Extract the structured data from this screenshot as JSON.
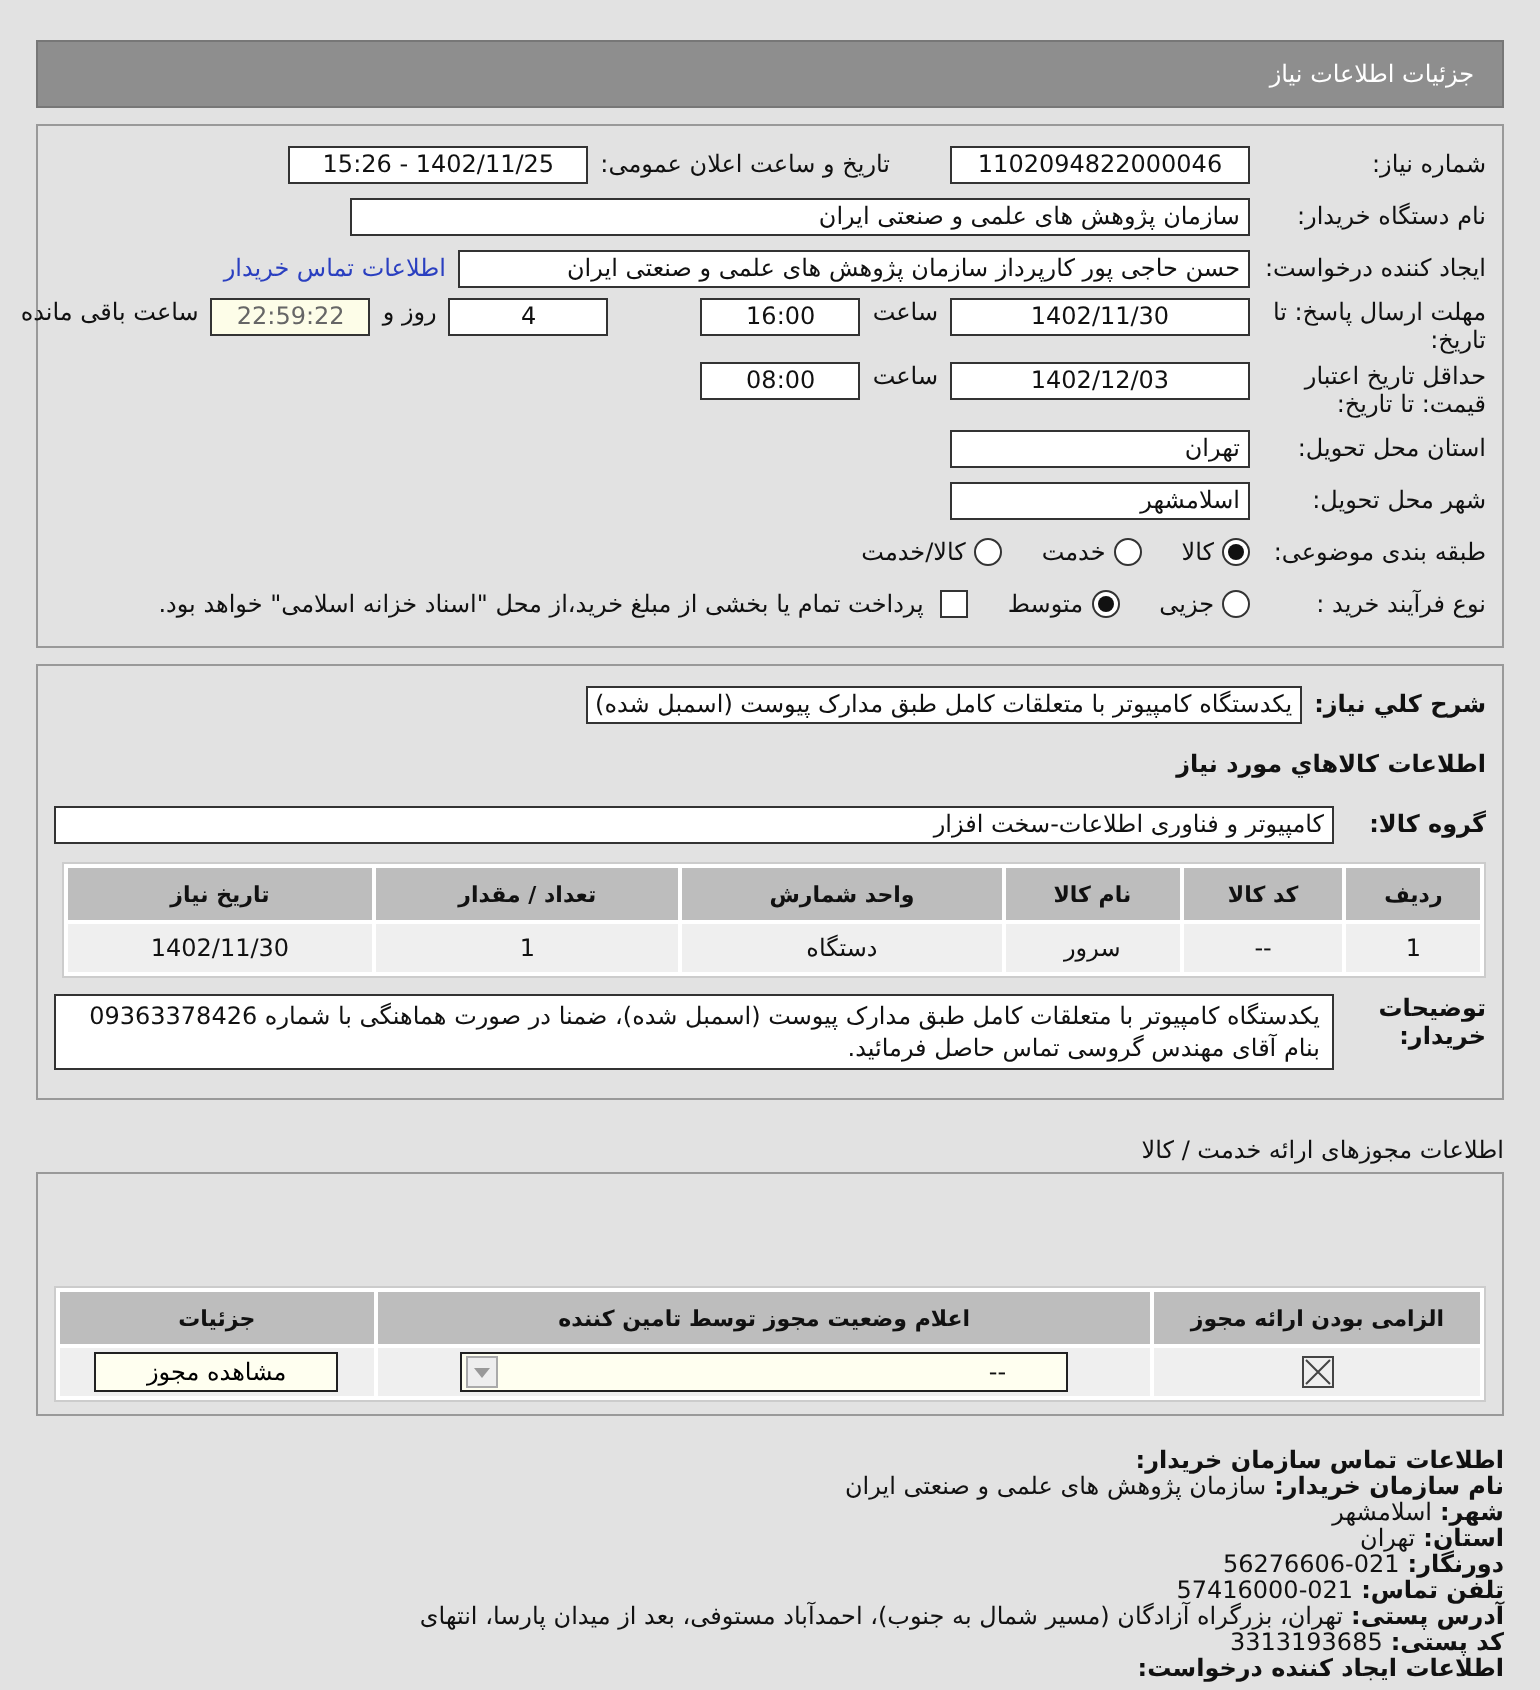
{
  "page_title": "جزئیات اطلاعات نیاز",
  "need": {
    "need_number_label": "شماره نیاز:",
    "need_number": "1102094822000046",
    "announce_label": "تاریخ و ساعت اعلان عمومی:",
    "announce_value": "1402/11/25 - 15:26",
    "buyer_label": "نام دستگاه خریدار:",
    "buyer": "سازمان پژوهش های علمی و صنعتی ایران",
    "creator_label": "ایجاد کننده درخواست:",
    "creator": "حسن حاجی پور کارپرداز سازمان پژوهش های علمی و صنعتی ایران",
    "contact_link": "اطلاعات تماس خریدار",
    "deadline_label": "مهلت ارسال پاسخ: تا تاریخ:",
    "deadline_date": "1402/11/30",
    "deadline_time_label": "ساعت",
    "deadline_time": "16:00",
    "days": "4",
    "days_label": "روز و",
    "remaining": "22:59:22",
    "remaining_label": "ساعت باقی مانده",
    "validity_label": "حداقل تاریخ اعتبار قیمت: تا تاریخ:",
    "validity_date": "1402/12/03",
    "validity_time_label": "ساعت",
    "validity_time": "08:00",
    "province_label": "استان محل تحویل:",
    "province": "تهران",
    "city_label": "شهر محل تحویل:",
    "city": "اسلامشهر",
    "category_label": "طبقه بندی موضوعی:",
    "category_options": [
      {
        "label": "کالا",
        "selected": true
      },
      {
        "label": "خدمت",
        "selected": false
      },
      {
        "label": "کالا/خدمت",
        "selected": false
      }
    ],
    "process_label": "نوع فرآیند خرید :",
    "process_options": [
      {
        "label": "جزیی",
        "selected": false
      },
      {
        "label": "متوسط",
        "selected": true
      }
    ],
    "treasury": {
      "checked": false,
      "label": "پرداخت تمام یا بخشی از مبلغ خرید،از محل \"اسناد خزانه اسلامی\" خواهد بود."
    }
  },
  "goods": {
    "summary_label": "شرح کلي نیاز:",
    "summary": "یکدستگاه کامپیوتر با متعلقات کامل طبق مدارک پیوست (اسمبل شده)",
    "section_title": "اطلاعات کالاهاي مورد نیاز",
    "group_label": "گروه کالا:",
    "group": "کامپیوتر و فناوری اطلاعات-سخت افزار",
    "table": {
      "columns": [
        "ردیف",
        "کد کالا",
        "نام کالا",
        "واحد شمارش",
        "تعداد / مقدار",
        "تاریخ نیاز"
      ],
      "rows": [
        [
          "1",
          "--",
          "سرور",
          "دستگاه",
          "1",
          "1402/11/30"
        ]
      ]
    },
    "notes_label": "توضیحات خریدار:",
    "notes": "یکدستگاه کامپیوتر با متعلقات کامل طبق مدارک پیوست (اسمبل شده)، ضمنا در صورت هماهنگی با شماره 09363378426 بنام آقای مهندس گروسی تماس حاصل فرمائید."
  },
  "permits": {
    "title": "اطلاعات مجوزهای ارائه خدمت / کالا",
    "columns": [
      "الزامی بودن ارائه مجوز",
      "اعلام وضعیت مجوز توسط تامین کننده",
      "جزئیات"
    ],
    "rows": [
      {
        "required": true,
        "status": "--",
        "button": "مشاهده مجوز"
      }
    ]
  },
  "contact": {
    "title": "اطلاعات تماس سازمان خریدار:",
    "lines": [
      {
        "label": "نام سازمان خریدار:",
        "value": "سازمان پژوهش های علمی و صنعتی ایران"
      },
      {
        "label": "شهر:",
        "value": "اسلامشهر"
      },
      {
        "label": "استان:",
        "value": "تهران"
      },
      {
        "label": "دورنگار:",
        "value": "021-56276606"
      },
      {
        "label": "تلفن تماس:",
        "value": "021-57416000"
      },
      {
        "label": "آدرس پستی:",
        "value": "تهران، بزرگراه آزادگان (مسیر شمال به جنوب)، احمدآباد مستوفی، بعد از میدان پارسا، انتهای"
      },
      {
        "label": "کد پستی:",
        "value": "3313193685"
      }
    ],
    "next_title": "اطلاعات ایجاد کننده درخواست:"
  }
}
